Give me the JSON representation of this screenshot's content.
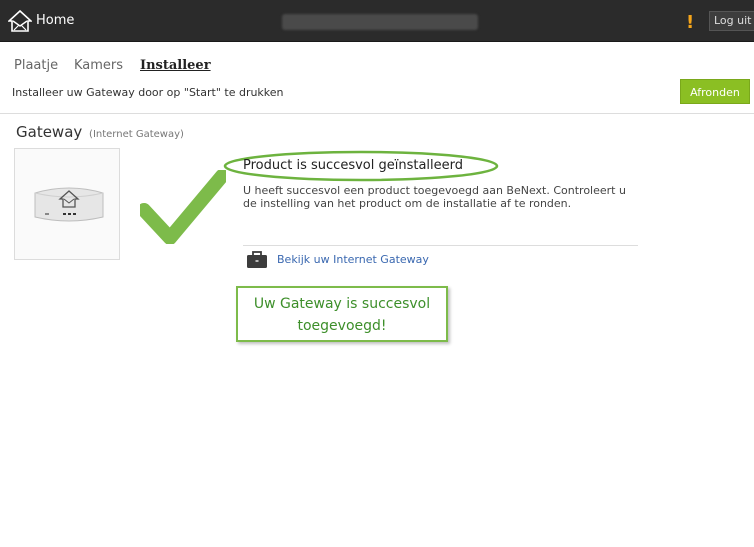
{
  "header": {
    "title": "Home",
    "alert_glyph": "!",
    "logout_label": "Log uit"
  },
  "nav": {
    "tabs": [
      "Plaatje",
      "Kamers",
      "Installeer"
    ],
    "active_tab": "Installeer"
  },
  "toolbar": {
    "instruction": "Installeer uw Gateway door op \"Start\" te drukken",
    "finish_label": "Afronden"
  },
  "product": {
    "title": "Gateway",
    "subtitle": "(Internet Gateway)",
    "icon": "gateway-device-icon"
  },
  "result": {
    "title": "Product is succesvol geïnstalleerd",
    "text": "U heeft succesvol een product toegevoegd aan BeNext. Controleert u de instelling van het product om de installatie af te ronden.",
    "link_label": "Bekijk uw Internet Gateway",
    "link_icon": "briefcase-icon"
  },
  "callout": {
    "line1": "Uw Gateway is succesvol",
    "line2": "toegevoegd!"
  },
  "colors": {
    "topbar": "#2b2b2b",
    "accent_green": "#8bbf23",
    "check_green": "#7dbb4a",
    "alert": "#f5a51a",
    "link": "#3a68b0"
  }
}
